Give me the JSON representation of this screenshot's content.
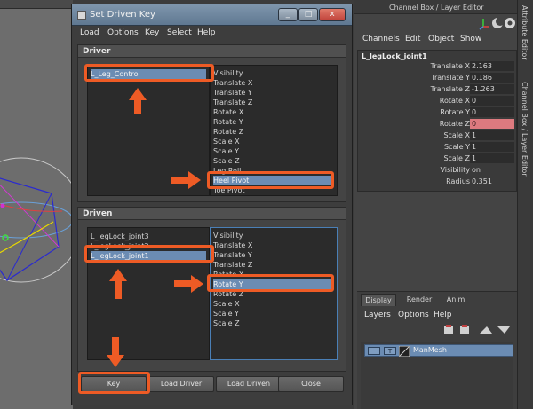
{
  "dialog": {
    "title": "Set Driven Key",
    "window_buttons": {
      "minimize": "_",
      "maximize": "□",
      "close": "x"
    },
    "menu": [
      "Load",
      "Options",
      "Key",
      "Select",
      "Help"
    ],
    "driver": {
      "header": "Driver",
      "objects": [
        "L_Leg_Control"
      ],
      "selected_object": "L_Leg_Control",
      "attributes": [
        "Visibility",
        "Translate X",
        "Translate Y",
        "Translate Z",
        "Rotate X",
        "Rotate Y",
        "Rotate Z",
        "Scale X",
        "Scale Y",
        "Scale Z",
        "Leg Roll",
        "Heel Pivot",
        "Toe Pivot"
      ],
      "selected_attribute": "Heel Pivot"
    },
    "driven": {
      "header": "Driven",
      "objects": [
        "L_legLock_joint3",
        "L_legLock_joint2",
        "L_legLock_joint1"
      ],
      "selected_object": "L_legLock_joint1",
      "attributes": [
        "Visibility",
        "Translate X",
        "Translate Y",
        "Translate Z",
        "Rotate X",
        "Rotate Y",
        "Rotate Z",
        "Scale X",
        "Scale Y",
        "Scale Z"
      ],
      "selected_attribute": "Rotate Y"
    },
    "buttons": {
      "key": "Key",
      "load_driver": "Load Driver",
      "load_driven": "Load Driven",
      "close": "Close"
    }
  },
  "channel_box": {
    "title": "Channel Box / Layer Editor",
    "menu": [
      "Channels",
      "Edit",
      "Object",
      "Show"
    ],
    "object_name": "L_legLock_joint1",
    "attributes": [
      {
        "label": "Translate X",
        "value": "2.163"
      },
      {
        "label": "Translate Y",
        "value": "0.186"
      },
      {
        "label": "Translate Z",
        "value": "-1.263"
      },
      {
        "label": "Rotate X",
        "value": "0"
      },
      {
        "label": "Rotate Y",
        "value": "0"
      },
      {
        "label": "Rotate Z",
        "value": "0"
      },
      {
        "label": "Scale X",
        "value": "1"
      },
      {
        "label": "Scale Y",
        "value": "1"
      },
      {
        "label": "Scale Z",
        "value": "1"
      },
      {
        "label": "Visibility",
        "value": "on"
      },
      {
        "label": "Radius",
        "value": "0.351"
      }
    ]
  },
  "layer_editor": {
    "tabs": [
      "Display",
      "Render",
      "Anim"
    ],
    "menu": [
      "Layers",
      "Options",
      "Help"
    ],
    "layer": {
      "v": "",
      "t": "T",
      "name": "ManMesh"
    }
  },
  "side_tabs": [
    "Attribute Editor",
    "Channel Box / Layer Editor"
  ],
  "colors": {
    "highlight_orange": "#ee5b25",
    "selection_blue": "#6b8cb3",
    "keyed_red": "#dd7a7f"
  }
}
